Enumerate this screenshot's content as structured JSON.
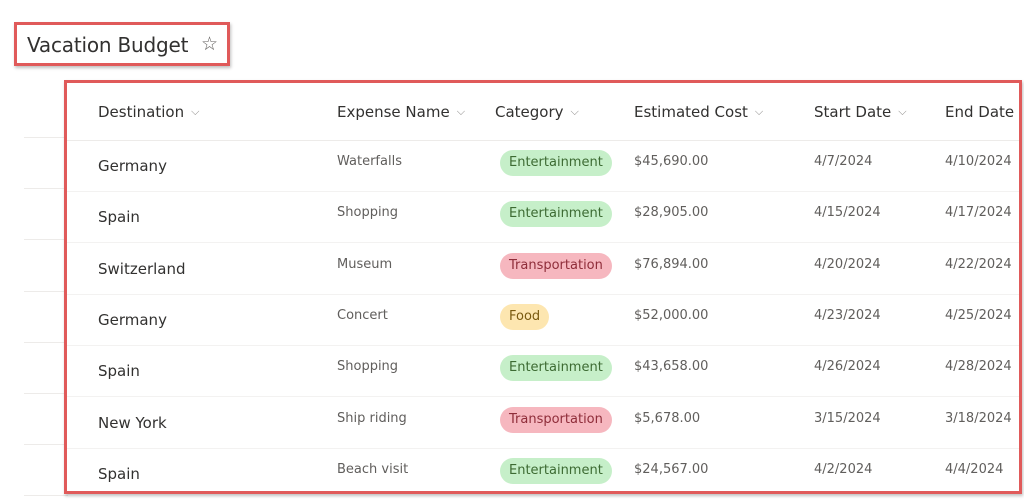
{
  "page": {
    "title": "Vacation Budget",
    "favorite_icon": "star-outline-icon"
  },
  "table": {
    "columns": [
      {
        "label": "Destination",
        "sortable": true
      },
      {
        "label": "Expense Name",
        "sortable": true
      },
      {
        "label": "Category",
        "sortable": true
      },
      {
        "label": "Estimated Cost",
        "sortable": true
      },
      {
        "label": "Start Date",
        "sortable": true
      },
      {
        "label": "End Date",
        "sortable": false
      }
    ],
    "chevron_glyph": "∨",
    "rows": [
      {
        "destination": "Germany",
        "expense": "Waterfalls",
        "category": "Entertainment",
        "category_color": "green",
        "cost": "$45,690.00",
        "start": "4/7/2024",
        "end": "4/10/2024"
      },
      {
        "destination": "Spain",
        "expense": "Shopping",
        "category": "Entertainment",
        "category_color": "green",
        "cost": "$28,905.00",
        "start": "4/15/2024",
        "end": "4/17/2024"
      },
      {
        "destination": "Switzerland",
        "expense": "Museum",
        "category": "Transportation",
        "category_color": "red",
        "cost": "$76,894.00",
        "start": "4/20/2024",
        "end": "4/22/2024"
      },
      {
        "destination": "Germany",
        "expense": "Concert",
        "category": "Food",
        "category_color": "yellow",
        "cost": "$52,000.00",
        "start": "4/23/2024",
        "end": "4/25/2024"
      },
      {
        "destination": "Spain",
        "expense": "Shopping",
        "category": "Entertainment",
        "category_color": "green",
        "cost": "$43,658.00",
        "start": "4/26/2024",
        "end": "4/28/2024"
      },
      {
        "destination": "New York",
        "expense": "Ship riding",
        "category": "Transportation",
        "category_color": "red",
        "cost": "$5,678.00",
        "start": "3/15/2024",
        "end": "3/18/2024"
      },
      {
        "destination": "Spain",
        "expense": "Beach visit",
        "category": "Entertainment",
        "category_color": "green",
        "cost": "$24,567.00",
        "start": "4/2/2024",
        "end": "4/4/2024"
      }
    ]
  },
  "colors": {
    "highlight_border": "#e05a5a",
    "pill_green_bg": "#c6efc9",
    "pill_red_bg": "#f6b7bf",
    "pill_yellow_bg": "#fde6b0"
  }
}
